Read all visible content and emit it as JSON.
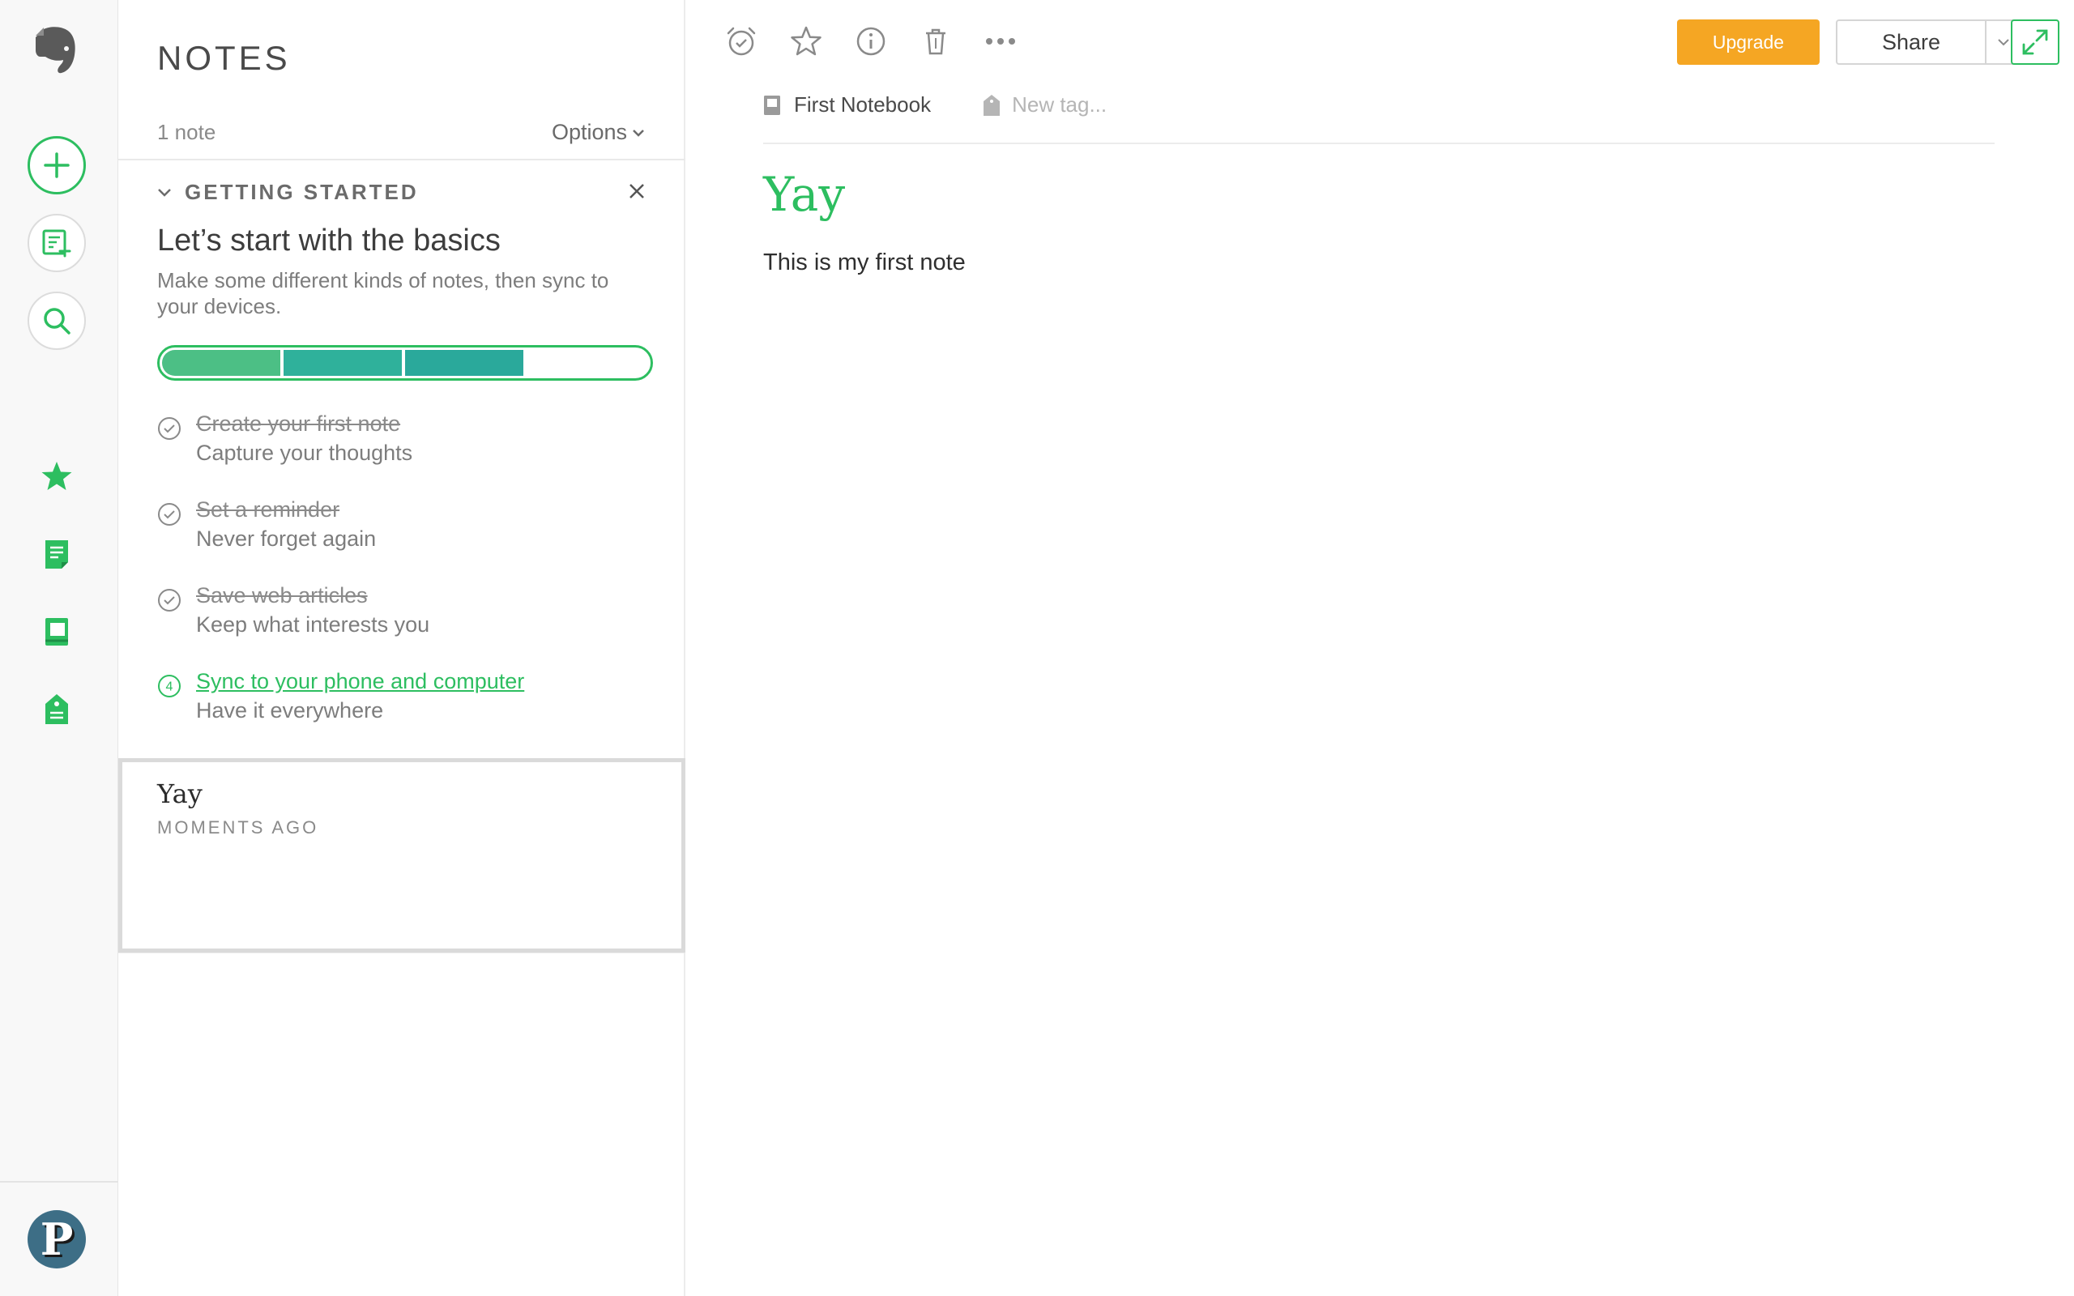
{
  "app": {
    "name": "Evernote"
  },
  "sidebar": {
    "new_note": "new-note",
    "avatar_letter": "P"
  },
  "list": {
    "title": "NOTES",
    "count": "1 note",
    "options_label": "Options"
  },
  "getting_started": {
    "heading": "GETTING STARTED",
    "title": "Let’s start with the basics",
    "subtitle": "Make some different kinds of notes, then sync to your devices.",
    "progress_completed": 3,
    "progress_total": 4,
    "tasks": [
      {
        "number": "1",
        "title": "Create your first note",
        "subtitle": "Capture your thoughts",
        "done": true
      },
      {
        "number": "2",
        "title": "Set a reminder",
        "subtitle": "Never forget again",
        "done": true
      },
      {
        "number": "3",
        "title": "Save web articles",
        "subtitle": "Keep what interests you",
        "done": true
      },
      {
        "number": "4",
        "title": "Sync to your phone and computer",
        "subtitle": "Have it everywhere",
        "done": false
      }
    ]
  },
  "note_card": {
    "title": "Yay",
    "date": "MOMENTS AGO"
  },
  "toolbar": {
    "upgrade_label": "Upgrade",
    "share_label": "Share"
  },
  "editor": {
    "notebook": "First Notebook",
    "tag_placeholder": "New tag...",
    "title": "Yay",
    "body": "This is my first note"
  },
  "colors": {
    "brand_green": "#2dbe60",
    "upgrade_orange": "#f5a623",
    "progress": [
      "#4cbf85",
      "#2fb19b",
      "#2aa99b"
    ]
  }
}
